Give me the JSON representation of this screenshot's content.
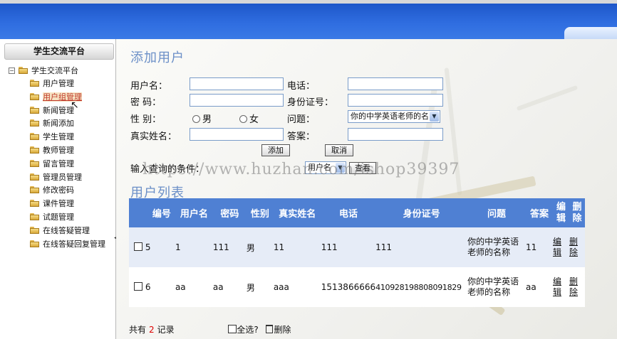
{
  "sidebar": {
    "title": "学生交流平台",
    "root": "学生交流平台",
    "items": [
      {
        "label": "用户管理"
      },
      {
        "label": "用户组管理"
      },
      {
        "label": "新闻管理"
      },
      {
        "label": "新闻添加"
      },
      {
        "label": "学生管理"
      },
      {
        "label": "教师管理"
      },
      {
        "label": "留言管理"
      },
      {
        "label": "管理员管理"
      },
      {
        "label": "修改密码"
      },
      {
        "label": "课件管理"
      },
      {
        "label": "试题管理"
      },
      {
        "label": "在线答疑管理"
      },
      {
        "label": "在线答疑回复管理"
      }
    ]
  },
  "add_form": {
    "title": "添加用户",
    "username_label": "用户名：",
    "phone_label": "电话：",
    "password_label": "密 码：",
    "id_label": "身份证号：",
    "gender_label": "性 别：",
    "male": "男",
    "female": "女",
    "question_label": "问题：",
    "question_value": "你的中学英语老师的名",
    "realname_label": "真实姓名：",
    "answer_label": "答案：",
    "add_button": "添加",
    "cancel_button": "取消"
  },
  "search": {
    "label": "输入查询的条件：",
    "field_value": "用户名",
    "button": "查看"
  },
  "watermark": "https://www.huzhan.com/ishop39397",
  "list": {
    "title": "用户列表",
    "headers": [
      "编号",
      "用户名",
      "密码",
      "性别",
      "真实姓名",
      "电话",
      "身份证号",
      "问题",
      "答案",
      "编辑",
      "删除"
    ],
    "rows": [
      {
        "id": "5",
        "username": "1",
        "password": "111",
        "gender": "男",
        "realname": "11",
        "phone": "111",
        "idcard": "111",
        "question": "你的中学英语老师的名称",
        "answer": "11",
        "edit": "编辑",
        "del": "删除"
      },
      {
        "id": "6",
        "username": "aa",
        "password": "aa",
        "gender": "男",
        "realname": "aaa",
        "phone": "1513866666",
        "idcard": "410928198808091829",
        "question": "你的中学英语老师的名称",
        "answer": "aa",
        "edit": "编辑",
        "del": "删除"
      }
    ]
  },
  "footer": {
    "prefix": "共有",
    "count": "2",
    "suffix": "记录",
    "select_all": "全选?",
    "delete": "删除"
  }
}
